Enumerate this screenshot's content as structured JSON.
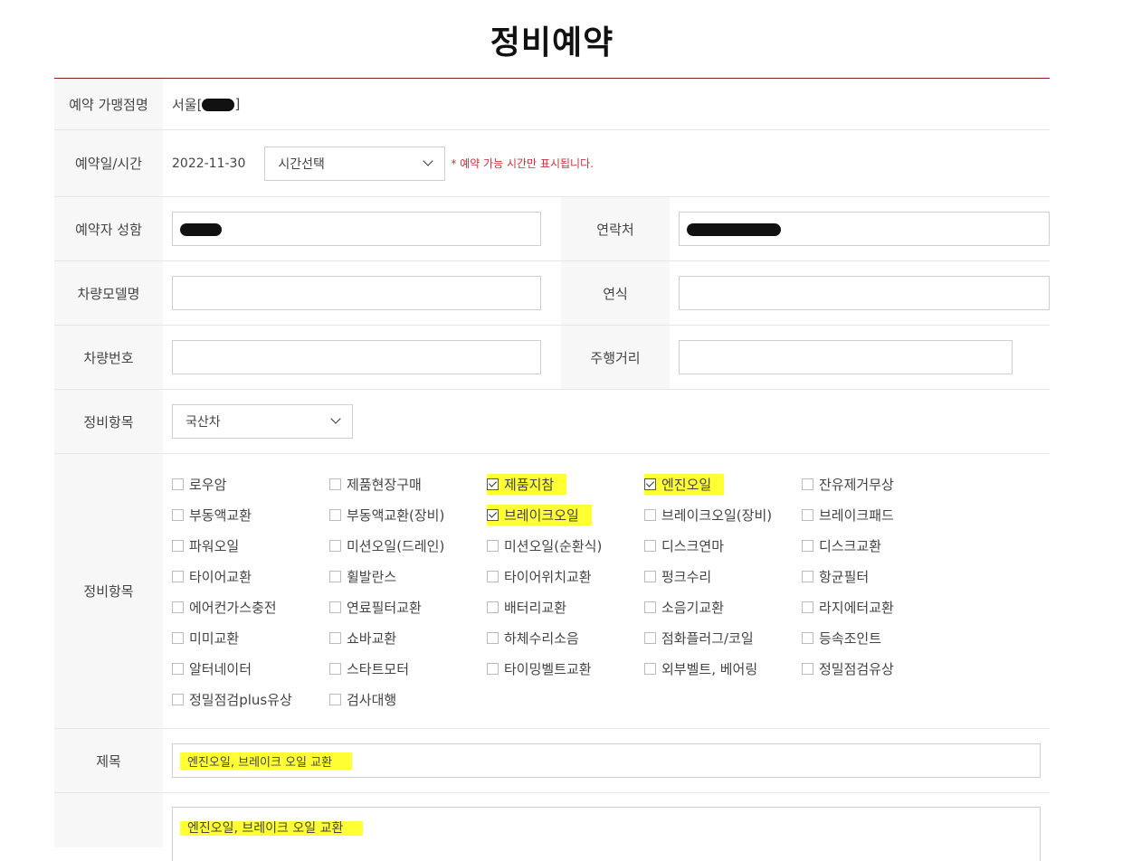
{
  "page": {
    "title": "정비예약"
  },
  "form": {
    "store_label": "예약 가맹점명",
    "store_value": "서울[",
    "store_suffix": "]",
    "date_label": "예약일/시간",
    "date_value": "2022-11-30",
    "time_select": "시간선택",
    "time_note": "* 예약 가능 시간만 표시됩니다.",
    "name_label": "예약자 성함",
    "contact_label": "연락처",
    "model_label": "차량모델명",
    "year_label": "연식",
    "plate_label": "차량번호",
    "mileage_label": "주행거리",
    "category_label": "정비항목",
    "category_select": "국산차",
    "items_label": "정비항목",
    "items": [
      {
        "label": "로우암",
        "checked": false
      },
      {
        "label": "제품현장구매",
        "checked": false
      },
      {
        "label": "제품지참",
        "checked": true
      },
      {
        "label": "엔진오일",
        "checked": true
      },
      {
        "label": "잔유제거무상",
        "checked": false
      },
      {
        "label": "부동액교환",
        "checked": false
      },
      {
        "label": "부동액교환(장비)",
        "checked": false
      },
      {
        "label": "브레이크오일",
        "checked": true
      },
      {
        "label": "브레이크오일(장비)",
        "checked": false
      },
      {
        "label": "브레이크패드",
        "checked": false
      },
      {
        "label": "파워오일",
        "checked": false
      },
      {
        "label": "미션오일(드레인)",
        "checked": false
      },
      {
        "label": "미션오일(순환식)",
        "checked": false
      },
      {
        "label": "디스크연마",
        "checked": false
      },
      {
        "label": "디스크교환",
        "checked": false
      },
      {
        "label": "타이어교환",
        "checked": false
      },
      {
        "label": "휠발란스",
        "checked": false
      },
      {
        "label": "타이어위치교환",
        "checked": false
      },
      {
        "label": "펑크수리",
        "checked": false
      },
      {
        "label": "항균필터",
        "checked": false
      },
      {
        "label": "에어컨가스충전",
        "checked": false
      },
      {
        "label": "연료필터교환",
        "checked": false
      },
      {
        "label": "배터리교환",
        "checked": false
      },
      {
        "label": "소음기교환",
        "checked": false
      },
      {
        "label": "라지에터교환",
        "checked": false
      },
      {
        "label": "미미교환",
        "checked": false
      },
      {
        "label": "쇼바교환",
        "checked": false
      },
      {
        "label": "하체수리소음",
        "checked": false
      },
      {
        "label": "점화플러그/코일",
        "checked": false
      },
      {
        "label": "등속조인트",
        "checked": false
      },
      {
        "label": "알터네이터",
        "checked": false
      },
      {
        "label": "스타트모터",
        "checked": false
      },
      {
        "label": "타이밍벨트교환",
        "checked": false
      },
      {
        "label": "외부벨트, 베어링",
        "checked": false
      },
      {
        "label": "정밀점검유상",
        "checked": false
      },
      {
        "label": "정밀점검plus유상",
        "checked": false
      },
      {
        "label": "검사대행",
        "checked": false
      }
    ],
    "subject_label": "제목",
    "subject_value": "엔진오일, 브레이크 오일 교환",
    "body_value": "엔진오일, 브레이크 오일 교환"
  }
}
